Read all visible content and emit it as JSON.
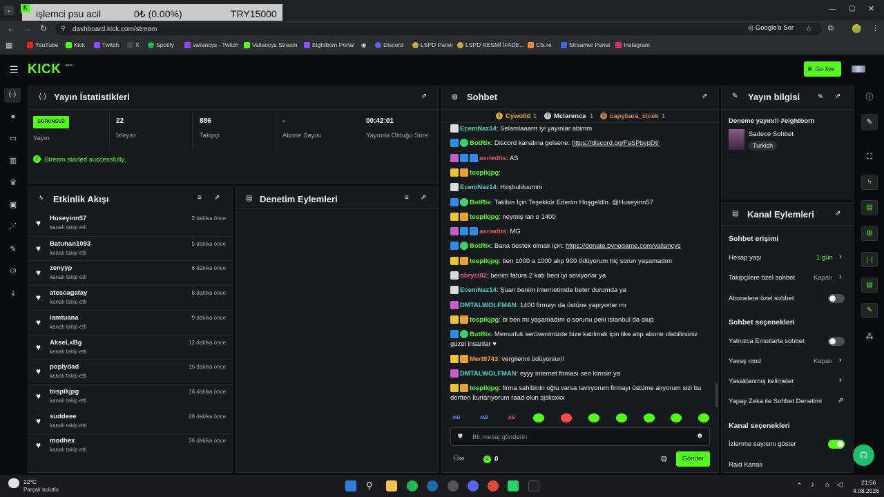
{
  "browser": {
    "ticker": {
      "name": "işlemci psu acil",
      "amount": "0₺ (0.00%)",
      "goal": "TRY15000"
    },
    "url": "dashboard.kick.com/stream",
    "google_btn": "Google'a Sor",
    "bookmarks": [
      "YouTube",
      "Kick",
      "Twitch",
      "X",
      "Spotify",
      "valiancys - Twitch",
      "Valiancys Stream",
      "Eightborn Portal",
      "Discord",
      "LSPD Panel",
      "LSPD  RESMİ İFADE...",
      "Cfx.re",
      "Streamer Panel",
      "Instagram"
    ]
  },
  "app": {
    "logo": "KICK",
    "beta": "BETA",
    "go_live": "Go live"
  },
  "stats": {
    "title": "Yayın İstatistikleri",
    "status_badge": "SORUNSUZ",
    "status_label": "Yayın",
    "viewers": "22",
    "viewers_label": "İzleyici",
    "followers": "886",
    "followers_label": "Takipçi",
    "subs": "-",
    "subs_label": "Abone Sayısı",
    "uptime": "00:42:01",
    "uptime_label": "Yayında Olduğu Süre",
    "message": "Stream started successfully."
  },
  "activity": {
    "title": "Etkinlik Akışı",
    "items": [
      {
        "name": "Huseyinn57",
        "sub": "kanalı takip etti",
        "time": "2 dakika önce"
      },
      {
        "name": "Batuhan1093",
        "sub": "kanalı takip etti",
        "time": "5 dakika önce"
      },
      {
        "name": "zenyyp",
        "sub": "kanalı takip etti",
        "time": "6 dakika önce"
      },
      {
        "name": "atescagatay",
        "sub": "kanalı takip etti",
        "time": "8 dakika önce"
      },
      {
        "name": "iamtuana",
        "sub": "kanalı takip etti",
        "time": "9 dakika önce"
      },
      {
        "name": "AkseLxBg",
        "sub": "kanalı takip etti",
        "time": "12 dakika önce"
      },
      {
        "name": "poplydad",
        "sub": "kanalı takip etti",
        "time": "16 dakika önce"
      },
      {
        "name": "tospikjpg",
        "sub": "kanalı takip etti",
        "time": "16 dakika önce"
      },
      {
        "name": "suddeee",
        "sub": "kanalı takip etti",
        "time": "28 dakika önce"
      },
      {
        "name": "modhex",
        "sub": "kanalı takip etti",
        "time": "36 dakika önce"
      }
    ]
  },
  "moderation": {
    "title": "Denetim Eylemleri"
  },
  "chat": {
    "title": "Sohbet",
    "top": [
      {
        "name": "Cywolid",
        "count": "1"
      },
      {
        "name": "Mclarenca",
        "count": "1"
      },
      {
        "name": "capybara_cicek",
        "count": "1"
      }
    ],
    "messages": [
      {
        "user": "EcemNaz14",
        "color": "#4fd1c5",
        "text": ": Selamlaaarrr iyi yayınlar abimm"
      },
      {
        "user": "BotRix",
        "color": "#53fc18",
        "text": ": Discord kanalına gelsene: ",
        "link": "https://discord.gg/FaSPbvpDtr"
      },
      {
        "user": "asriedits",
        "color": "#e05a5a",
        "text": ": AS"
      },
      {
        "user": "tospikjpg",
        "color": "#53fc18",
        "text": ":"
      },
      {
        "user": "EcemNaz14",
        "color": "#4fd1c5",
        "text": ": Hoşbulduumm"
      },
      {
        "user": "BotRix",
        "color": "#53fc18",
        "text": ": Takibin İçin Teşekkür Ederim Hoşgeldin. @Huseyinn57"
      },
      {
        "user": "tospikjpg",
        "color": "#53fc18",
        "text": ": neymiş lan o 1400"
      },
      {
        "user": "asriedits",
        "color": "#e05a5a",
        "text": ": MG"
      },
      {
        "user": "BotRix",
        "color": "#53fc18",
        "text": ": Bana destek olmak için: ",
        "link": "https://donate.bynogame.com/valiancys"
      },
      {
        "user": "tospikjpg",
        "color": "#53fc18",
        "text": ": ben 1000 a 1000 alıp 900 ödüyorum hiç sorun yaşamadım"
      },
      {
        "user": "obrycl02",
        "color": "#e05a8a",
        "text": ": benim fatura 2 katı beni iyi seviyorlar ya"
      },
      {
        "user": "EcemNaz14",
        "color": "#4fd1c5",
        "text": ": Şuan benim internetimde beter durumda ya"
      },
      {
        "user": "DMTALWOLFMAN",
        "color": "#4fd1c5",
        "text": ": 1400 firmayı da üstüne yapıyorlar mı"
      },
      {
        "user": "tospikjpg",
        "color": "#53fc18",
        "text": ": bi ben mi yaşamadım o sorunu peki istanbul da olup"
      },
      {
        "user": "BotRix",
        "color": "#53fc18",
        "text": ": Memurluk serüvenimizde bize katılmak için like atıp abone olabilirsiniz güzel insanlar ♥"
      },
      {
        "user": "Mert8743",
        "color": "#f0a030",
        "text": ": vergilerini ödüyorsun!"
      },
      {
        "user": "DMTALWOLFMAN",
        "color": "#4fd1c5",
        "text": ": eyyy internet firması sen kimsin ya"
      },
      {
        "user": "tospikjpg",
        "color": "#53fc18",
        "text": ": firma sahibinin oğlu varsa tavlıyorum firmayı üstüme alıyorum sizi bu dertten kurtarıyorum raad olun sjsksxkx"
      }
    ],
    "emotes": [
      "MG",
      "MB",
      "AS",
      "",
      "",
      "",
      "",
      "",
      "",
      ""
    ],
    "placeholder": "Bir mesaj gönderin",
    "points": "0",
    "send": "Gönder"
  },
  "stream_info": {
    "title": "Yayın bilgisi",
    "stream_title": "Deneme yayını!! #eightborn",
    "category": "Sadece Sohbet",
    "tag": "Turkish"
  },
  "channel_actions": {
    "title": "Kanal Eylemleri",
    "chat_access": "Sohbet erişimi",
    "account_age": "Hesap yaşı",
    "account_age_val": "1 gün",
    "followers_only": "Takipçilere özel sohbet",
    "followers_only_val": "Kapalı",
    "subs_only": "Abonelere özel sohbet",
    "chat_options": "Sohbet seçenekleri",
    "emote_only": "Yalnızca Emotlarla sohbet",
    "slow_mode": "Yavaş mod",
    "slow_mode_val": "Kapalı",
    "banned_words": "Yasaklanmış kelimeler",
    "ai_mod": "Yapay Zeka ile Sohbet Denetimi",
    "channel_options": "Kanal seçenekleri",
    "show_viewers": "İzlenme sayısını göster",
    "raid": "Raid Kanalı"
  },
  "taskbar": {
    "temp": "22°C",
    "weather": "Parçalı bulutlu",
    "time": "21:56",
    "date": "4.08.2026"
  },
  "colors": {
    "accent": "#53fc18",
    "panel": "#171a1c",
    "bg": "#0a0b0c"
  }
}
